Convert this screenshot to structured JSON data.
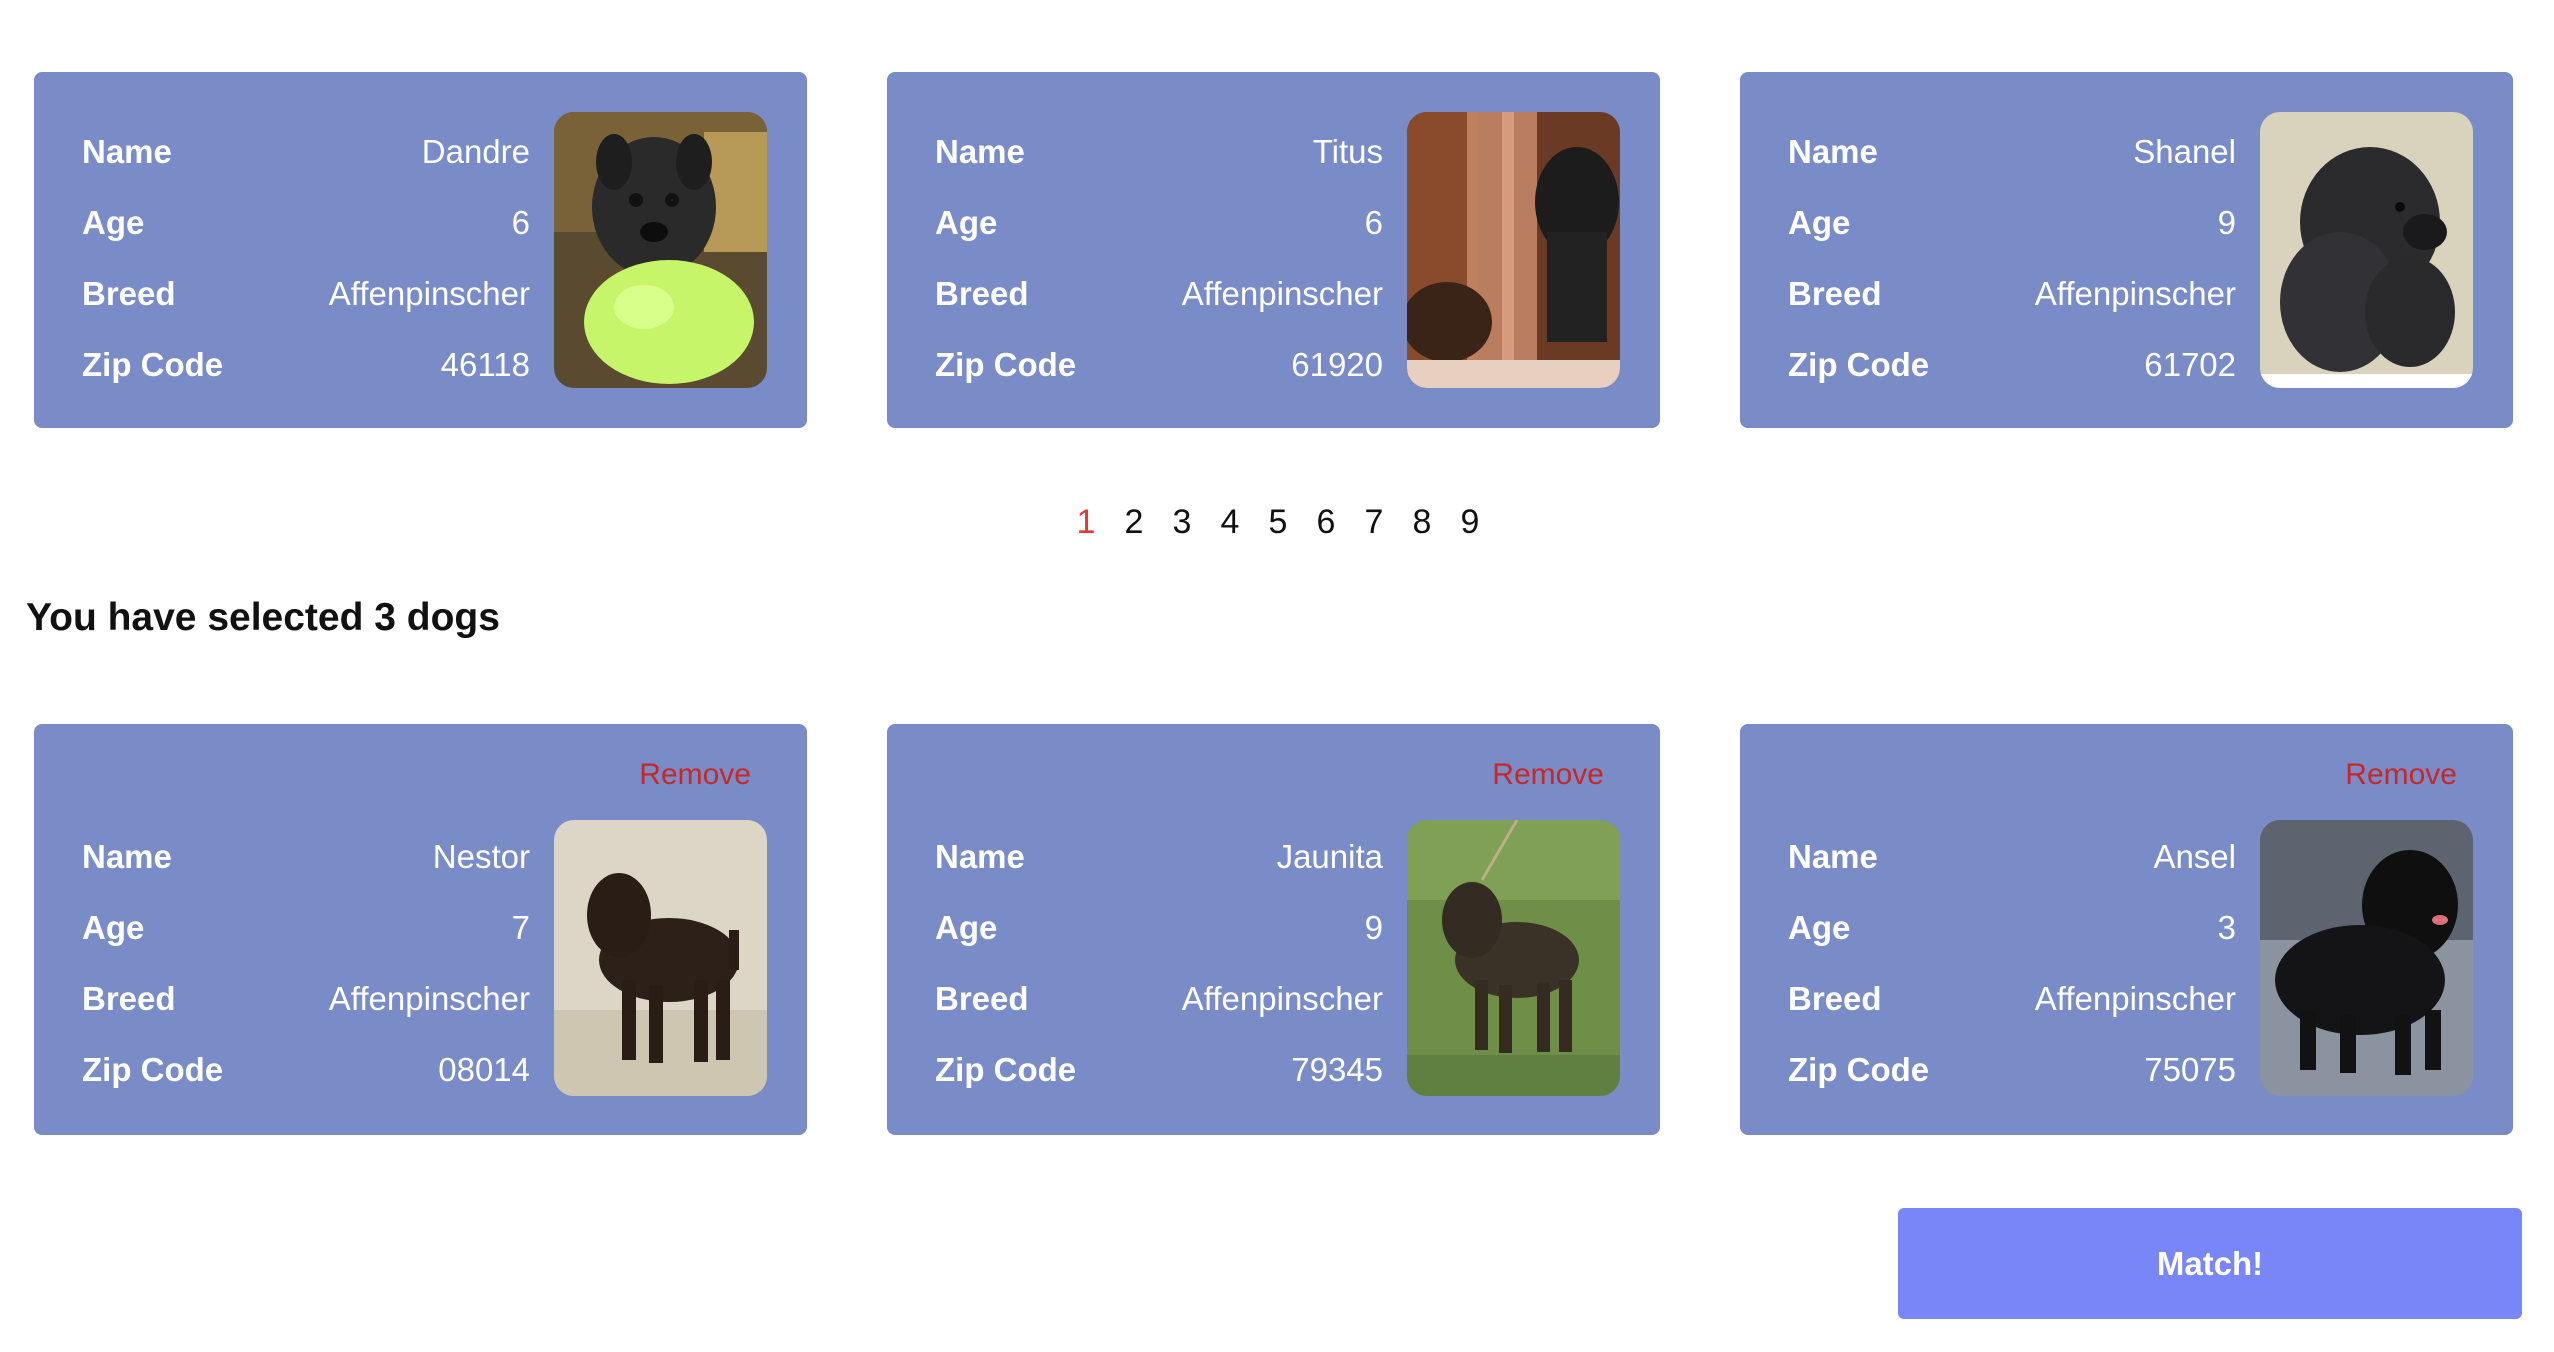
{
  "labels": {
    "name": "Name",
    "age": "Age",
    "breed": "Breed",
    "zip": "Zip Code",
    "remove": "Remove"
  },
  "results": [
    {
      "name": "Dandre",
      "age": "6",
      "breed": "Affenpinscher",
      "zip": "46118"
    },
    {
      "name": "Titus",
      "age": "6",
      "breed": "Affenpinscher",
      "zip": "61920"
    },
    {
      "name": "Shanel",
      "age": "9",
      "breed": "Affenpinscher",
      "zip": "61702"
    }
  ],
  "pagination": {
    "pages": [
      "1",
      "2",
      "3",
      "4",
      "5",
      "6",
      "7",
      "8",
      "9"
    ],
    "active": "1"
  },
  "selected_heading": "You have selected 3 dogs",
  "selected": [
    {
      "name": "Nestor",
      "age": "7",
      "breed": "Affenpinscher",
      "zip": "08014"
    },
    {
      "name": "Jaunita",
      "age": "9",
      "breed": "Affenpinscher",
      "zip": "79345"
    },
    {
      "name": "Ansel",
      "age": "3",
      "breed": "Affenpinscher",
      "zip": "75075"
    }
  ],
  "match_button": "Match!",
  "colors": {
    "card": "#7a8cc8",
    "remove": "#c62828",
    "active_page": "#e53935",
    "match_button": "#7986f7"
  }
}
